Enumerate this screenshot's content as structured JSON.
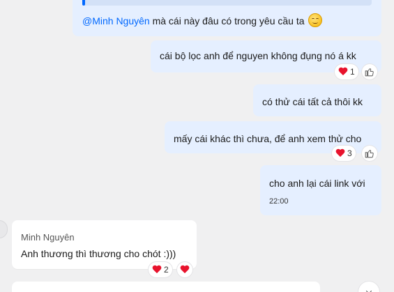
{
  "messages": [
    {
      "id": "m1",
      "side": "mine",
      "mention": "@Minh Nguyên",
      "text": " mà cái này đâu có trong yêu cầu ta",
      "emoji": "smiling-face-icon"
    },
    {
      "id": "m2",
      "side": "mine",
      "text": "cái bộ lọc anh để nguyen không đụng nó á kk",
      "reaction": {
        "icon": "heart-icon",
        "count": "1"
      }
    },
    {
      "id": "m3",
      "side": "mine",
      "text": "có thử cái tất cả thôi kk"
    },
    {
      "id": "m4",
      "side": "mine",
      "text": "mấy cái khác thì chưa, để anh xem thử cho",
      "reaction": {
        "icon": "heart-icon",
        "count": "3"
      }
    },
    {
      "id": "m5",
      "side": "mine",
      "text": "cho anh lại cái link với",
      "time": "22:00"
    },
    {
      "id": "m6",
      "side": "other",
      "sender": "Minh Nguyên",
      "text": "Anh thương thì thương cho chót :)))",
      "reaction": {
        "icon": "heart-icon",
        "count": "2"
      }
    }
  ],
  "colors": {
    "background": "#f0f0f1",
    "mine_bubble": "#e5efff",
    "other_bubble": "#ffffff",
    "mention": "#0068ff",
    "heart": "#e8132d"
  }
}
